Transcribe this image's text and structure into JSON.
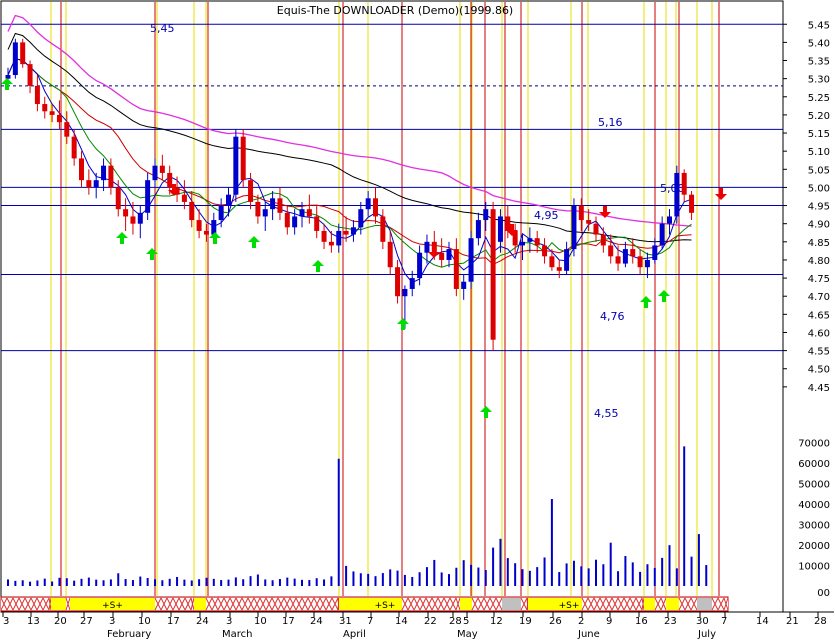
{
  "title": "Equis-The DOWNLOADER (Demo)(1999.86)",
  "chart_data": {
    "type": "candlestick",
    "title": "Equis-The DOWNLOADER (Demo)(1999.86)",
    "price_axis": {
      "ylim": [
        4.4,
        5.47
      ],
      "ticks": [
        "5.45",
        "5.40",
        "5.35",
        "5.30",
        "5.25",
        "5.20",
        "5.15",
        "5.10",
        "5.05",
        "5.00",
        "4.95",
        "4.90",
        "4.85",
        "4.80",
        "4.75",
        "4.70",
        "4.65",
        "4.60",
        "4.55",
        "4.50",
        "4.45"
      ]
    },
    "volume_axis": {
      "ylim": [
        0,
        76000
      ],
      "ticks": [
        "70000",
        "60000",
        "50000",
        "40000",
        "30000",
        "20000",
        "10000",
        "00"
      ]
    },
    "x_axis": {
      "day_ticks": [
        "3",
        "13",
        "20",
        "27",
        "3",
        "10",
        "17",
        "24",
        "3",
        "10",
        "17",
        "24",
        "31",
        "7",
        "14",
        "22",
        "28",
        "5",
        "12",
        "19",
        "26",
        "2",
        "9",
        "16",
        "23",
        "30",
        "7",
        "14",
        "21",
        "28"
      ],
      "month_labels": [
        "February",
        "March",
        "April",
        "May",
        "June",
        "July"
      ]
    },
    "horizontal_levels": [
      {
        "label": "5,45",
        "value": 5.45
      },
      {
        "label": "5,16",
        "value": 5.16
      },
      {
        "label": "5,00",
        "value": 5.0
      },
      {
        "label": "4,95",
        "value": 4.95
      },
      {
        "label": "4,76",
        "value": 4.76
      },
      {
        "label": "4,55",
        "value": 4.55
      }
    ],
    "dashed_level": 5.28,
    "candles": [
      [
        5.3,
        5.33,
        5.28,
        5.31
      ],
      [
        5.31,
        5.41,
        5.3,
        5.4
      ],
      [
        5.4,
        5.41,
        5.33,
        5.34
      ],
      [
        5.34,
        5.35,
        5.26,
        5.28
      ],
      [
        5.28,
        5.31,
        5.21,
        5.23
      ],
      [
        5.23,
        5.25,
        5.19,
        5.21
      ],
      [
        5.21,
        5.23,
        5.18,
        5.2
      ],
      [
        5.2,
        5.24,
        5.16,
        5.18
      ],
      [
        5.18,
        5.21,
        5.12,
        5.14
      ],
      [
        5.14,
        5.16,
        5.06,
        5.08
      ],
      [
        5.08,
        5.1,
        5.0,
        5.02
      ],
      [
        5.02,
        5.05,
        4.98,
        5.0
      ],
      [
        5.0,
        5.04,
        4.97,
        5.02
      ],
      [
        5.02,
        5.08,
        4.99,
        5.06
      ],
      [
        5.06,
        5.08,
        4.98,
        5.0
      ],
      [
        5.0,
        5.02,
        4.92,
        4.94
      ],
      [
        4.94,
        4.97,
        4.88,
        4.92
      ],
      [
        4.92,
        4.96,
        4.87,
        4.9
      ],
      [
        4.9,
        4.95,
        4.86,
        4.93
      ],
      [
        4.93,
        5.04,
        4.91,
        5.02
      ],
      [
        5.02,
        5.08,
        5.0,
        5.06
      ],
      [
        5.06,
        5.09,
        5.02,
        5.04
      ],
      [
        5.04,
        5.06,
        4.98,
        5.0
      ],
      [
        5.0,
        5.03,
        4.96,
        4.98
      ],
      [
        4.98,
        5.02,
        4.94,
        4.96
      ],
      [
        4.96,
        4.99,
        4.89,
        4.91
      ],
      [
        4.91,
        4.94,
        4.86,
        4.88
      ],
      [
        4.88,
        4.9,
        4.85,
        4.87
      ],
      [
        4.87,
        4.93,
        4.85,
        4.91
      ],
      [
        4.91,
        4.97,
        4.89,
        4.95
      ],
      [
        4.95,
        5.0,
        4.92,
        4.98
      ],
      [
        4.98,
        5.16,
        4.96,
        5.14
      ],
      [
        5.14,
        5.16,
        5.0,
        5.02
      ],
      [
        5.02,
        5.04,
        4.94,
        4.96
      ],
      [
        4.96,
        4.98,
        4.9,
        4.92
      ],
      [
        4.92,
        4.96,
        4.88,
        4.94
      ],
      [
        4.94,
        4.99,
        4.91,
        4.97
      ],
      [
        4.97,
        5.0,
        4.91,
        4.93
      ],
      [
        4.93,
        4.95,
        4.87,
        4.89
      ],
      [
        4.89,
        4.94,
        4.87,
        4.92
      ],
      [
        4.92,
        4.96,
        4.89,
        4.94
      ],
      [
        4.94,
        4.98,
        4.9,
        4.92
      ],
      [
        4.92,
        4.95,
        4.86,
        4.88
      ],
      [
        4.88,
        4.9,
        4.83,
        4.85
      ],
      [
        4.85,
        4.88,
        4.82,
        4.84
      ],
      [
        4.84,
        4.9,
        4.82,
        4.88
      ],
      [
        4.88,
        4.92,
        4.85,
        4.87
      ],
      [
        4.87,
        4.91,
        4.85,
        4.89
      ],
      [
        4.89,
        4.96,
        4.87,
        4.94
      ],
      [
        4.94,
        4.99,
        4.92,
        4.97
      ],
      [
        4.97,
        5.0,
        4.9,
        4.92
      ],
      [
        4.92,
        4.94,
        4.83,
        4.85
      ],
      [
        4.85,
        4.88,
        4.76,
        4.78
      ],
      [
        4.78,
        4.8,
        4.68,
        4.7
      ],
      [
        4.7,
        4.73,
        4.61,
        4.72
      ],
      [
        4.72,
        4.77,
        4.7,
        4.75
      ],
      [
        4.75,
        4.84,
        4.73,
        4.82
      ],
      [
        4.82,
        4.87,
        4.79,
        4.85
      ],
      [
        4.85,
        4.88,
        4.8,
        4.82
      ],
      [
        4.82,
        4.86,
        4.78,
        4.8
      ],
      [
        4.8,
        4.85,
        4.78,
        4.83
      ],
      [
        4.83,
        4.86,
        4.7,
        4.72
      ],
      [
        4.72,
        4.76,
        4.69,
        4.74
      ],
      [
        4.74,
        4.88,
        4.72,
        4.86
      ],
      [
        4.86,
        4.93,
        4.84,
        4.91
      ],
      [
        4.91,
        4.96,
        4.88,
        4.94
      ],
      [
        4.94,
        4.96,
        4.55,
        4.58
      ],
      [
        4.85,
        4.94,
        4.82,
        4.92
      ],
      [
        4.92,
        4.95,
        4.86,
        4.88
      ],
      [
        4.88,
        4.9,
        4.82,
        4.84
      ],
      [
        4.84,
        4.87,
        4.8,
        4.85
      ],
      [
        4.85,
        4.89,
        4.82,
        4.86
      ],
      [
        4.86,
        4.88,
        4.82,
        4.84
      ],
      [
        4.84,
        4.86,
        4.79,
        4.81
      ],
      [
        4.81,
        4.83,
        4.77,
        4.78
      ],
      [
        4.78,
        4.8,
        4.75,
        4.77
      ],
      [
        4.77,
        4.85,
        4.76,
        4.83
      ],
      [
        4.83,
        4.97,
        4.81,
        4.95
      ],
      [
        4.95,
        4.97,
        4.88,
        4.91
      ],
      [
        4.91,
        4.94,
        4.88,
        4.9
      ],
      [
        4.9,
        4.92,
        4.85,
        4.87
      ],
      [
        4.87,
        4.89,
        4.82,
        4.84
      ],
      [
        4.84,
        4.87,
        4.79,
        4.81
      ],
      [
        4.81,
        4.84,
        4.77,
        4.79
      ],
      [
        4.79,
        4.85,
        4.78,
        4.83
      ],
      [
        4.83,
        4.86,
        4.79,
        4.81
      ],
      [
        4.81,
        4.83,
        4.76,
        4.78
      ],
      [
        4.78,
        4.82,
        4.75,
        4.8
      ],
      [
        4.8,
        4.86,
        4.79,
        4.84
      ],
      [
        4.84,
        4.92,
        4.83,
        4.9
      ],
      [
        4.9,
        4.94,
        4.87,
        4.92
      ],
      [
        4.92,
        5.06,
        4.9,
        5.04
      ],
      [
        5.04,
        5.05,
        4.96,
        4.98
      ],
      [
        4.98,
        4.99,
        4.91,
        4.93
      ]
    ],
    "volume": [
      3200,
      2500,
      2800,
      2100,
      2700,
      3600,
      2200,
      4000,
      3800,
      2600,
      3500,
      4100,
      3100,
      2800,
      3200,
      6200,
      3400,
      2900,
      4600,
      3900,
      3300,
      2800,
      3500,
      4400,
      3100,
      2700,
      3300,
      4000,
      3500,
      2900,
      3100,
      4200,
      3300,
      4800,
      5600,
      3200,
      2800,
      3400,
      4100,
      3600,
      3000,
      2900,
      3800,
      3200,
      4700,
      62000,
      9800,
      7100,
      6200,
      5900,
      4800,
      6300,
      8100,
      7500,
      5400,
      4400,
      6700,
      9200,
      12700,
      6600,
      5800,
      8900,
      12600,
      10300,
      9000,
      7800,
      18700,
      23000,
      13600,
      11100,
      8200,
      7400,
      9200,
      13900,
      42400,
      6800,
      11000,
      12300,
      9600,
      8600,
      12800,
      10600,
      21100,
      7200,
      14600,
      11500,
      6900,
      10600,
      8800,
      13700,
      19900,
      8600,
      68000,
      14300,
      25300,
      10200
    ],
    "legend": []
  }
}
